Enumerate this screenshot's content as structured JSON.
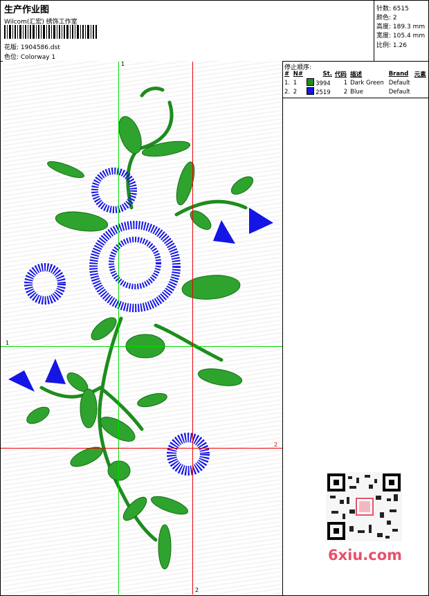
{
  "header": {
    "title": "生产作业图",
    "company": "Wilcom(汇宏) 绣饰工作室",
    "design_label": "花版:",
    "design_file": "1904586.dst",
    "colorway_label": "色位:",
    "colorway": "Colorway 1"
  },
  "stats": {
    "stitches_label": "针数:",
    "stitches": "6515",
    "colors_label": "颜色:",
    "colors": "2",
    "height_label": "高度:",
    "height": "189.3 mm",
    "width_label": "宽度:",
    "width": "105.4 mm",
    "scale_label": "比例:",
    "scale": "1.26"
  },
  "stop_sequence": {
    "title": "停止顺序:",
    "columns": [
      "#",
      "N#",
      "St.",
      "代码",
      "描述",
      "Brand",
      "元素"
    ],
    "rows": [
      {
        "index": "1.",
        "n": "1",
        "color": "#1e8c1e",
        "st": "3994",
        "code": "1",
        "desc": "Dark Green",
        "brand": "Default"
      },
      {
        "index": "2.",
        "n": "2",
        "color": "#1515e6",
        "st": "2519",
        "code": "2",
        "desc": "Blue",
        "brand": "Default"
      }
    ]
  },
  "guides": {
    "green_label_v": "1",
    "green_label_h": "1",
    "red_label_v": "2",
    "red_label_h": "2"
  },
  "colors": {
    "green": "#1e8c1e",
    "blue": "#1515e6",
    "guide_green": "#00dd00",
    "guide_red": "#ee0000",
    "watermark": "#e8516a"
  },
  "watermark": {
    "text": "6xiu.com",
    "qr_icon": "qr-code-icon"
  }
}
